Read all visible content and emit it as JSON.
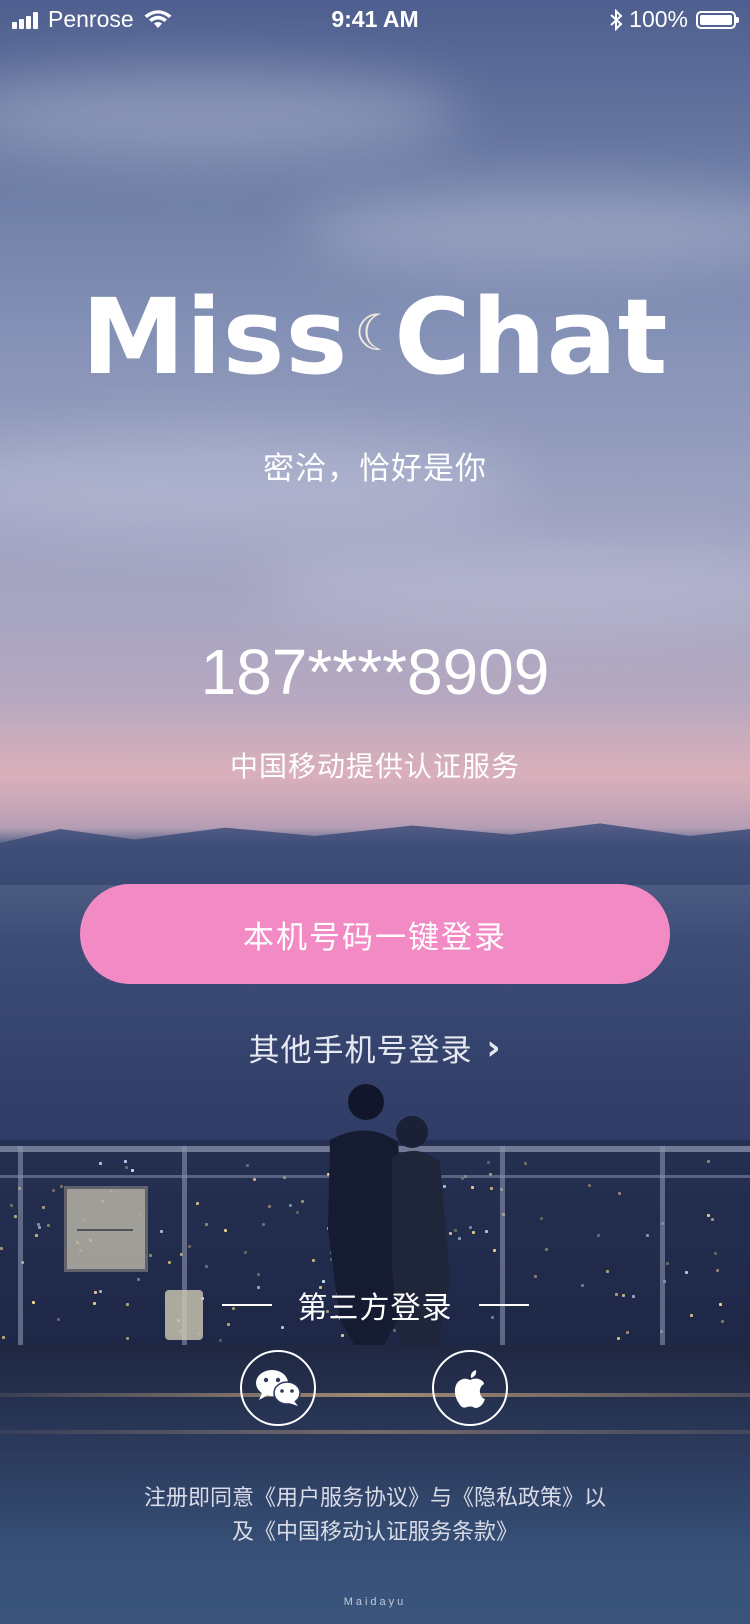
{
  "status_bar": {
    "carrier": "Penrose",
    "time": "9:41 AM",
    "battery_percent": "100%"
  },
  "brand": {
    "logo_text_left": "Miss",
    "logo_text_right": "Chat",
    "tagline": "密洽，恰好是你"
  },
  "account": {
    "masked_phone": "187****8909",
    "provider_note": "中国移动提供认证服务"
  },
  "actions": {
    "one_click_login": "本机号码一键登录",
    "other_phone_login": "其他手机号登录"
  },
  "third_party": {
    "title": "第三方登录",
    "providers": [
      "wechat-icon",
      "apple-icon"
    ]
  },
  "terms": {
    "line1": "注册即同意《用户服务协议》与《隐私政策》以",
    "line2": "及《中国移动认证服务条款》"
  },
  "watermark": "Maidayu",
  "colors": {
    "accent": "#f28ac4"
  }
}
